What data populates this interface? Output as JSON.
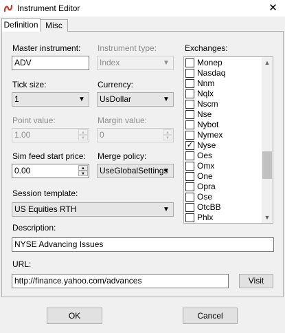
{
  "window": {
    "title": "Instrument Editor",
    "close_glyph": "✕",
    "icon": "ninjatrader-logo-icon",
    "accent": "#c0392b"
  },
  "tabs": [
    {
      "label": "Definition"
    },
    {
      "label": "Misc"
    }
  ],
  "form": {
    "master_instrument": {
      "label": "Master instrument:",
      "value": "ADV"
    },
    "instrument_type": {
      "label": "Instrument type:",
      "value": "Index",
      "enabled": false
    },
    "tick_size": {
      "label": "Tick size:",
      "value": "1"
    },
    "currency": {
      "label": "Currency:",
      "value": "UsDollar"
    },
    "point_value": {
      "label": "Point value:",
      "value": "1.00",
      "enabled": false
    },
    "margin_value": {
      "label": "Margin value:",
      "value": "0",
      "enabled": false
    },
    "sim_feed_start_price": {
      "label": "Sim feed start price:",
      "value": "0.00"
    },
    "merge_policy": {
      "label": "Merge policy:",
      "value": "UseGlobalSettings"
    },
    "session_template": {
      "label": "Session template:",
      "value": "US Equities RTH"
    },
    "description": {
      "label": "Description:",
      "value": "NYSE Advancing Issues"
    },
    "url": {
      "label": "URL:",
      "value": "http://finance.yahoo.com/advances"
    },
    "visit_label": "Visit"
  },
  "exchanges": {
    "label": "Exchanges:",
    "items": [
      {
        "name": "Monep",
        "checked": false
      },
      {
        "name": "Nasdaq",
        "checked": false
      },
      {
        "name": "Nnm",
        "checked": false
      },
      {
        "name": "Nqlx",
        "checked": false
      },
      {
        "name": "Nscm",
        "checked": false
      },
      {
        "name": "Nse",
        "checked": false
      },
      {
        "name": "Nybot",
        "checked": false
      },
      {
        "name": "Nymex",
        "checked": false
      },
      {
        "name": "Nyse",
        "checked": true
      },
      {
        "name": "Oes",
        "checked": false
      },
      {
        "name": "Omx",
        "checked": false
      },
      {
        "name": "One",
        "checked": false
      },
      {
        "name": "Opra",
        "checked": false
      },
      {
        "name": "Ose",
        "checked": false
      },
      {
        "name": "OtcBB",
        "checked": false
      },
      {
        "name": "Phlx",
        "checked": false
      }
    ]
  },
  "footer": {
    "ok_label": "OK",
    "cancel_label": "Cancel"
  }
}
